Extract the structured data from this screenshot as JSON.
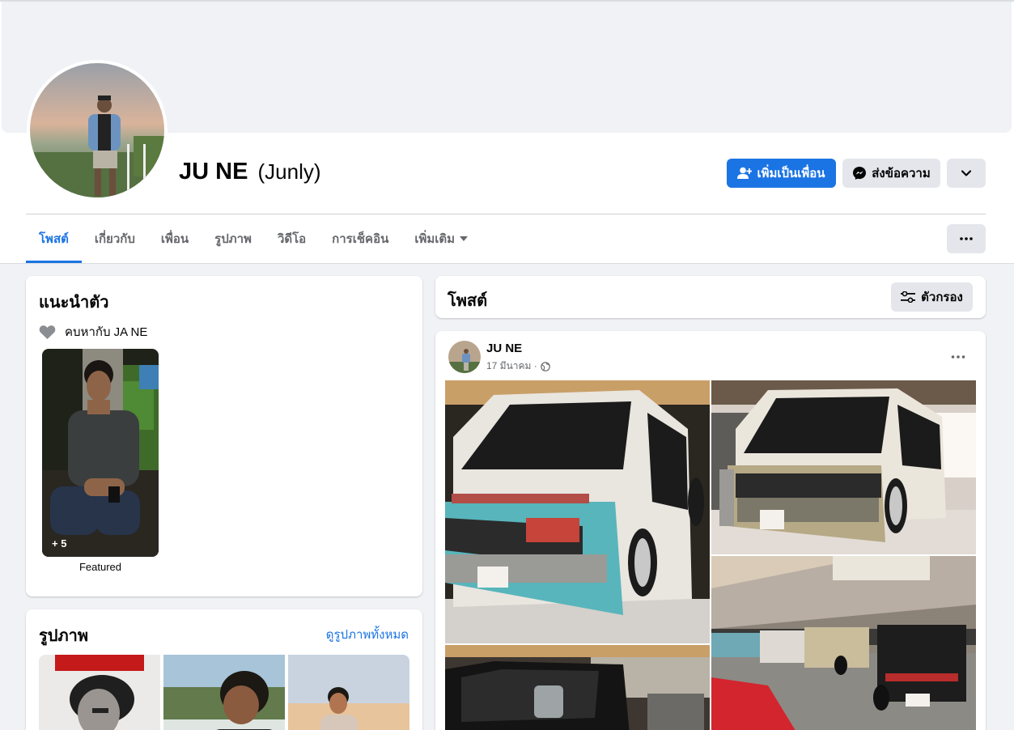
{
  "profile": {
    "name": "JU NE",
    "alternate_name": "(Junly)"
  },
  "actions": {
    "add_friend": "เพิ่มเป็นเพื่อน",
    "message": "ส่งข้อความ"
  },
  "tabs": [
    {
      "label": "โพสต์",
      "active": true
    },
    {
      "label": "เกี่ยวกับ"
    },
    {
      "label": "เพื่อน"
    },
    {
      "label": "รูปภาพ"
    },
    {
      "label": "วิดีโอ"
    },
    {
      "label": "การเช็คอิน"
    },
    {
      "label": "เพิ่มเติม"
    }
  ],
  "intro": {
    "title": "แนะนำตัว",
    "relationship": "คบหากับ JA NE",
    "featured_count": "+ 5",
    "featured_label": "Featured"
  },
  "photos": {
    "title": "รูปภาพ",
    "see_all": "ดูรูปภาพทั้งหมด"
  },
  "posts_section": {
    "title": "โพสต์",
    "filter_label": "ตัวกรอง"
  },
  "post": {
    "author": "JU NE",
    "date": "17 มีนาคม ·"
  },
  "colors": {
    "primary": "#1b74e4",
    "secondary_button": "#e4e6eb",
    "page_background": "#f0f2f5"
  },
  "icons": [
    "add-friend-icon",
    "messenger-icon",
    "chevron-down-icon",
    "more-icon",
    "heart-icon",
    "filter-icon",
    "globe-icon",
    "caret-down-icon"
  ]
}
